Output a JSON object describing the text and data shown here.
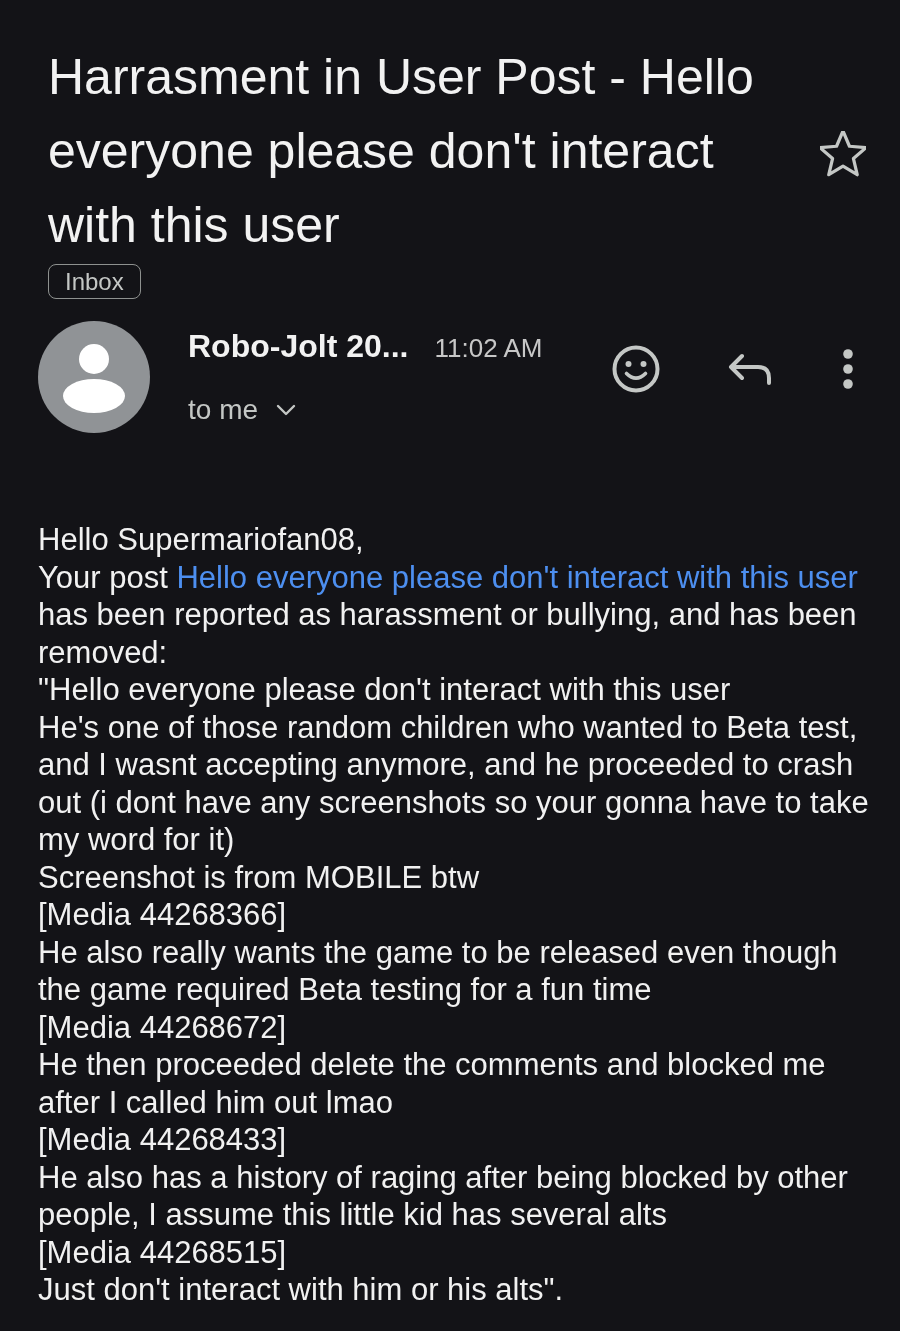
{
  "subject": {
    "title": "Harrasment in User Post - Hello everyone please don't interact with this user",
    "label": "Inbox",
    "starred": false
  },
  "message": {
    "sender": "Robo-Jolt 20...",
    "time": "11:02 AM",
    "recipient": "to me"
  },
  "body": {
    "paragraphs": [
      {
        "kind": "plain",
        "text": "Hello Supermariofan08,"
      },
      {
        "kind": "linked",
        "before": "Your post",
        "link": "Hello everyone please don't interact with this user",
        "after": "has been reported as harassment or bullying, and has been removed:"
      },
      {
        "kind": "plain",
        "text": "\"Hello everyone please don't interact with this user"
      },
      {
        "kind": "plain",
        "text": "He's one of those random children who wanted to Beta test, and I wasnt accepting anymore, and he proceeded to crash out (i dont have any screenshots so your gonna have to take my word for it)"
      },
      {
        "kind": "plain",
        "text": "Screenshot is from MOBILE btw"
      },
      {
        "kind": "plain",
        "text": "[Media 44268366]"
      },
      {
        "kind": "plain",
        "text": "He also really wants the game to be released even though the game required Beta testing for a fun time"
      },
      {
        "kind": "plain",
        "text": "[Media 44268672]"
      },
      {
        "kind": "plain",
        "text": "He then proceeded delete the comments and blocked me after I called him out lmao"
      },
      {
        "kind": "plain",
        "text": "[Media 44268433]"
      },
      {
        "kind": "plain",
        "text": "He also has a history of raging after being blocked by other people, I assume this little kid has several alts"
      },
      {
        "kind": "plain",
        "text": "[Media 44268515]"
      },
      {
        "kind": "plain",
        "text": "Just don't interact with him or his alts\"."
      }
    ]
  }
}
